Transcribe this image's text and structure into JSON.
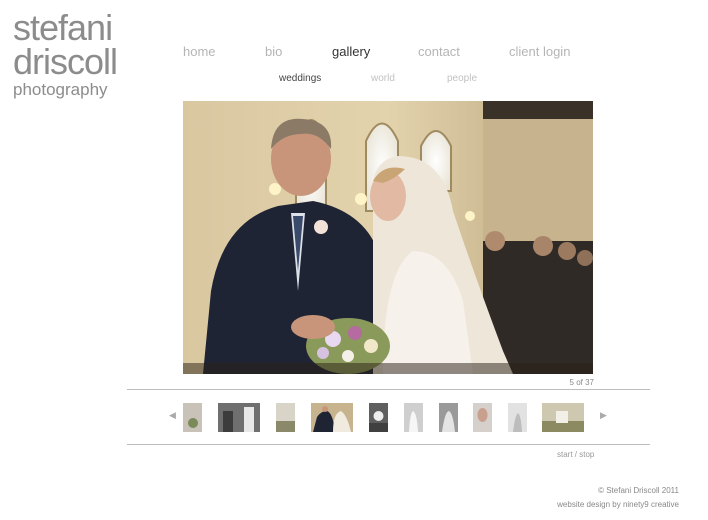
{
  "logo": {
    "line1": "stefani",
    "line2": "driscoll",
    "line3": "photography"
  },
  "nav": {
    "items": [
      {
        "label": "home",
        "active": false
      },
      {
        "label": "bio",
        "active": false
      },
      {
        "label": "gallery",
        "active": true
      },
      {
        "label": "contact",
        "active": false
      },
      {
        "label": "client login",
        "active": false
      }
    ]
  },
  "subnav": {
    "items": [
      {
        "label": "weddings",
        "active": true
      },
      {
        "label": "world",
        "active": false
      },
      {
        "label": "people",
        "active": false
      }
    ]
  },
  "photo": {
    "counter": "5 of 37"
  },
  "filmstrip": {
    "prev_icon": "◀",
    "next_icon": "▶",
    "thumb_count": 10,
    "selected_index": 3
  },
  "controls": {
    "start": "start",
    "separator": " / ",
    "stop": "stop"
  },
  "footer": {
    "copyright": "© Stefani Driscoll 2011",
    "credit": "website design by ninety9 creative"
  },
  "colors": {
    "nav_inactive": "#b5b5b5",
    "nav_active": "#333333",
    "rule": "#bdbdbd"
  }
}
